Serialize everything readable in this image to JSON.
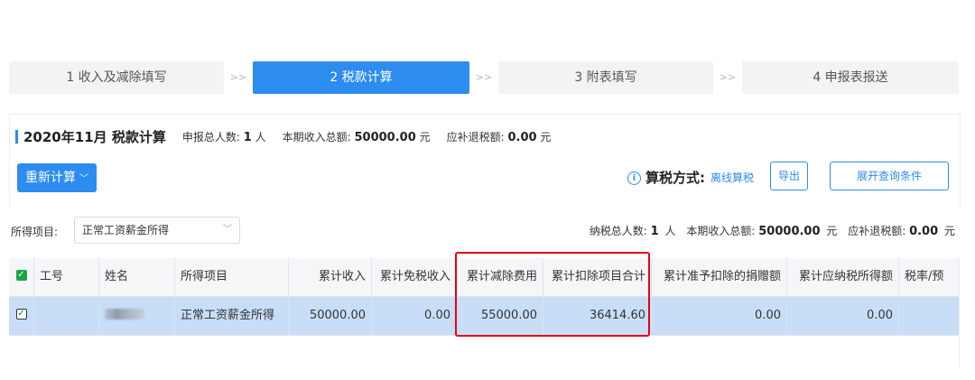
{
  "steps": [
    {
      "label": "1 收入及减除填写",
      "active": false
    },
    {
      "label": "2 税款计算",
      "active": true
    },
    {
      "label": "3 附表填写",
      "active": false
    },
    {
      "label": "4 申报表报送",
      "active": false
    }
  ],
  "step_separator": ">>",
  "panel": {
    "title": "2020年11月 税款计算",
    "declared_count_label": "申报总人数:",
    "declared_count_value": "1",
    "declared_count_unit": "人",
    "income_total_label": "本期收入总额:",
    "income_total_value": "50000.00",
    "income_total_unit": "元",
    "refund_label": "应补退税额:",
    "refund_value": "0.00",
    "refund_unit": "元",
    "recalc_button": "重新计算",
    "method_label": "算税方式:",
    "method_value": "离线算税",
    "export_button": "导出",
    "expand_button": "展开查询条件"
  },
  "filter": {
    "label": "所得项目:",
    "selected": "正常工资薪金所得"
  },
  "summary": {
    "taxpayers_label": "纳税总人数:",
    "taxpayers_value": "1",
    "taxpayers_unit": "人",
    "income_label": "本期收入总额:",
    "income_value": "50000.00",
    "income_unit": "元",
    "refund_label": "应补退税额:",
    "refund_value": "0.00",
    "refund_unit": "元"
  },
  "table": {
    "headers": [
      "工号",
      "姓名",
      "所得项目",
      "累计收入",
      "累计免税收入",
      "累计减除费用",
      "累计扣除项目合计",
      "累计准予扣除的捐赠额",
      "累计应纳税所得额",
      "税率/预"
    ],
    "rows": [
      [
        "",
        "",
        "正常工资薪金所得",
        "50000.00",
        "0.00",
        "55000.00",
        "36414.60",
        "0.00",
        "0.00",
        ""
      ]
    ]
  },
  "colors": {
    "primary": "#2d8cf0",
    "highlight_border": "#e60012",
    "selected_row": "#c8def7",
    "checkbox_green": "#19a34a"
  }
}
